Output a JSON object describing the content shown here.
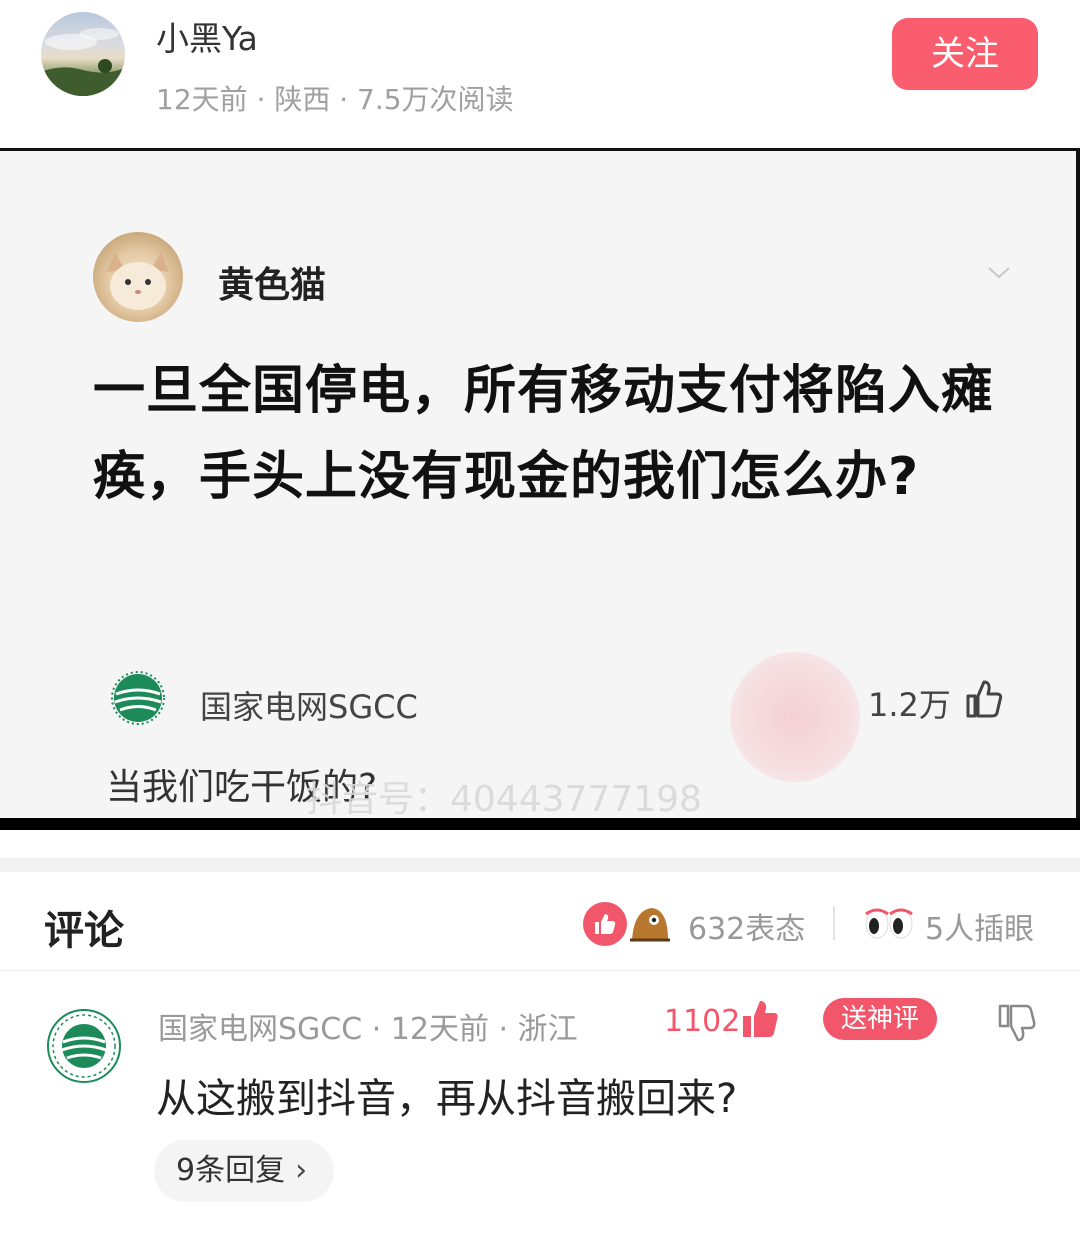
{
  "author": {
    "name": "小黑Ya",
    "meta": "12天前 · 陕西 · 7.5万次阅读",
    "follow_label": "关注"
  },
  "embedded_post": {
    "user_name": "黄色猫",
    "question": "一旦全国停电，所有移动支付将陷入瘫痪，手头上没有现金的我们怎么办?",
    "reply": {
      "author": "国家电网SGCC",
      "likes": "1.2万",
      "text": "当我们吃干饭的?"
    },
    "watermark": "抖音号：40443777198"
  },
  "comments_header": {
    "title": "评论",
    "reaction_count": "632表态",
    "peek_count": "5人插眼"
  },
  "comment": {
    "meta": "国家电网SGCC · 12天前 · 浙江",
    "likes": "1102",
    "badge": "送神评",
    "text": "从这搬到抖音，再从抖音搬回来?",
    "replies_label": "9条回复",
    "replies_arrow": "›"
  },
  "colors": {
    "accent": "#f95d6e",
    "accent_dark": "#f2566b",
    "meta_gray": "#a0a0a0"
  },
  "icons": [
    "chevron-down-icon",
    "thumb-up-icon",
    "like-reaction-icon",
    "emoji-reaction-icon",
    "eyes-icon",
    "dislike-icon",
    "sgcc-logo"
  ]
}
